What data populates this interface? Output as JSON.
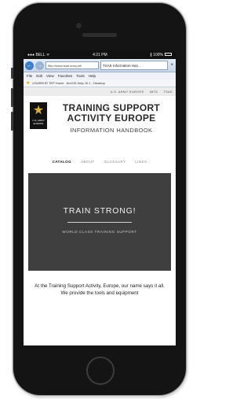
{
  "status_bar": {
    "carrier": "●●● BELL ᯤ",
    "time": "4:21 PM",
    "battery": "∦ 100%"
  },
  "browser": {
    "address_text": "http://www.tsae.army.mil",
    "tab_label": "TSAE Information Han...",
    "menu": [
      "File",
      "Edit",
      "View",
      "Favorites",
      "Tools",
      "Help"
    ],
    "favorites": [
      "USAREUR TEP Home",
      "ArcGIS Help 10.1 - Desktop"
    ]
  },
  "site": {
    "top_links": [
      "U.S. ARMY EUROPE",
      "IMTE",
      "TSAE"
    ],
    "logo_text": "U.S. ARMY EUROPE",
    "title_line1": "TRAINING SUPPORT",
    "title_line2": "ACTIVITY EUROPE",
    "subtitle": "INFORMATION HANDBOOK",
    "nav": [
      "CATALOG",
      "ABOUT",
      "GLOSSARY",
      "LINKS"
    ],
    "hero_title": "TRAIN STRONG!",
    "hero_subtitle": "WORLD CLASS TRAINING SUPPORT",
    "intro_text": "At the Training Support Activity, Europe, our name says it all. We provide the tools and equipment"
  }
}
